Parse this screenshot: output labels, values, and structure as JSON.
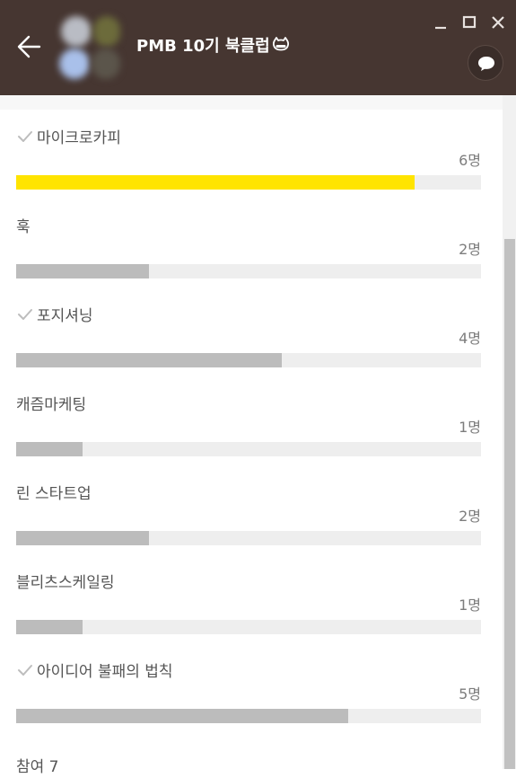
{
  "window": {
    "title": "PMB 10기 북클럽",
    "title_icon": "cat-face-icon",
    "header_color": "#463631"
  },
  "poll": {
    "options": [
      {
        "label": "마이크로카피",
        "count": "6명",
        "votes": 6,
        "checked": true,
        "leading": true
      },
      {
        "label": "훅",
        "count": "2명",
        "votes": 2,
        "checked": false,
        "leading": false
      },
      {
        "label": "포지셔닝",
        "count": "4명",
        "votes": 4,
        "checked": true,
        "leading": false
      },
      {
        "label": "캐즘마케팅",
        "count": "1명",
        "votes": 1,
        "checked": false,
        "leading": false
      },
      {
        "label": "린 스타트업",
        "count": "2명",
        "votes": 2,
        "checked": false,
        "leading": false
      },
      {
        "label": "블리츠스케일링",
        "count": "1명",
        "votes": 1,
        "checked": false,
        "leading": false
      },
      {
        "label": "아이디어 불패의 법칙",
        "count": "5명",
        "votes": 5,
        "checked": true,
        "leading": false
      }
    ],
    "participants_label": "참여 7",
    "participants_total": 7,
    "colors": {
      "leading": "#ffe400",
      "normal": "#bcbcbc",
      "track": "#eeeeee"
    }
  }
}
